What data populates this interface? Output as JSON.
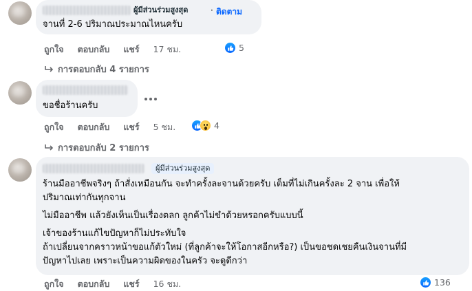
{
  "comments": [
    {
      "badge": "ผู้มีส่วนร่วมสูงสุด",
      "follow": "ติดตาม",
      "separator": "·",
      "lines": [
        "จานที่ 2-6 ปริมาณประมาณไหนครับ"
      ],
      "like": "ถูกใจ",
      "reply": "ตอบกลับ",
      "share": "แชร์",
      "time": "17 ชม.",
      "reaction_count": "5",
      "reaction_icons": [
        "like-icon"
      ],
      "replies_link": "การตอบกลับ 4 รายการ"
    },
    {
      "lines": [
        "ขอชื่อร้านครับ"
      ],
      "like": "ถูกใจ",
      "reply": "ตอบกลับ",
      "share": "แชร์",
      "time": "5 ชม.",
      "reaction_count": "4",
      "reaction_icons": [
        "like-icon",
        "wow-icon"
      ],
      "replies_link": "การตอบกลับ 2 รายการ"
    },
    {
      "badge": "ผู้มีส่วนร่วมสูงสุด",
      "lines": [
        "ร้านมืออาชีพจริงๆ ถ้าสั่งเหมือนกัน จะทำครั้งละจานด้วยครับ เต็มที่ไม่เกินครั้งละ 2 จาน เพื่อให้",
        "ปริมาณเท่ากันทุกจาน",
        "ไม่มืออาชีพ แล้วยังเห็นเป็นเรื่องตลก ลูกค้าไม่ขำด้วยหรอกครับแบบนี้",
        "เจ้าของร้านแก้ไขปัญหาก็ไม่ประทับใจ",
        "ถ้าเปลี่ยนจากคราวหน้าขอแก้ตัวใหม่ (ที่ลูกค้าจะให้โอกาสอีกหรือ?) เป็นขอชดเชยคืนเงินจานที่มี",
        "ปัญหาไปเลย เพราะเป็นความผิดของในครัว จะดูดีกว่า"
      ],
      "like": "ถูกใจ",
      "reply": "ตอบกลับ",
      "share": "แชร์",
      "time": "16 ชม.",
      "reaction_count": "136",
      "reaction_icons": [
        "like-icon"
      ]
    }
  ],
  "colors": {
    "bubble": "#f0f2f5",
    "link": "#0866ff",
    "meta": "#65676b",
    "badge_bg": "#e7f0fd"
  }
}
